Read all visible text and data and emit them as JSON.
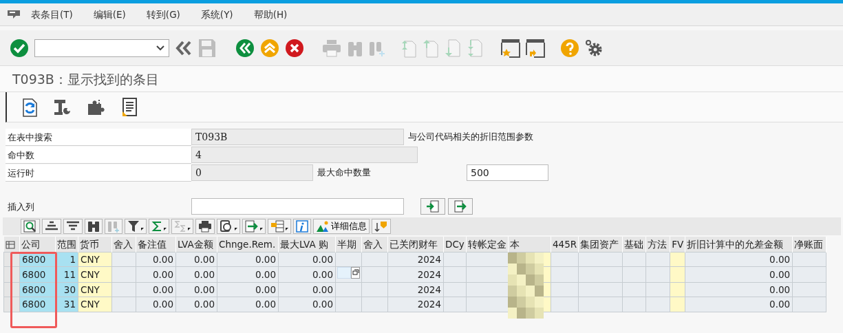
{
  "menu": [
    {
      "label": "表条目(T)"
    },
    {
      "label": "编辑(E)"
    },
    {
      "label": "转到(G)"
    },
    {
      "label": "系统(Y)"
    },
    {
      "label": "帮助(H)"
    }
  ],
  "toolbar": [
    {
      "kind": "check",
      "disabled": false
    },
    {
      "kind": "command-field",
      "disabled": false
    },
    {
      "kind": "chevrons",
      "disabled": false
    },
    {
      "kind": "save",
      "disabled": true
    },
    {
      "kind": "back",
      "disabled": false
    },
    {
      "kind": "exit",
      "disabled": false
    },
    {
      "kind": "cancel",
      "disabled": false
    },
    {
      "kind": "print",
      "disabled": true
    },
    {
      "kind": "find",
      "disabled": true
    },
    {
      "kind": "find-next",
      "disabled": true
    },
    {
      "kind": "page-first",
      "disabled": true
    },
    {
      "kind": "page-up",
      "disabled": true
    },
    {
      "kind": "page-down",
      "disabled": true
    },
    {
      "kind": "page-last",
      "disabled": true
    },
    {
      "kind": "new-window",
      "disabled": false
    },
    {
      "kind": "shortcut",
      "disabled": false
    },
    {
      "kind": "help",
      "disabled": false
    },
    {
      "kind": "settings",
      "disabled": false
    }
  ],
  "title": "T093B：显示找到的条目",
  "app_toolbar": [
    {
      "kind": "refresh"
    },
    {
      "kind": "tools"
    },
    {
      "kind": "puzzle"
    },
    {
      "kind": "document"
    }
  ],
  "form": {
    "rows": [
      {
        "label": "在表中搜索",
        "value": "T093B",
        "note": "与公司代码相关的折旧范围参数"
      },
      {
        "label": "命中数",
        "value": "4"
      },
      {
        "label": "运行时",
        "value": "0",
        "extra_label": "最大命中数量",
        "extra_value": "500"
      }
    ],
    "insert_label": "插入列"
  },
  "alv_toolbar": [
    {
      "kind": "details",
      "menu": false
    },
    {
      "kind": "sort-up",
      "menu": false
    },
    {
      "kind": "sort-down",
      "menu": false
    },
    {
      "kind": "find",
      "menu": false
    },
    {
      "kind": "find-next",
      "menu": false,
      "disabled": true
    },
    {
      "kind": "filter",
      "menu": true
    },
    {
      "kind": "sum",
      "menu": true
    },
    {
      "kind": "subtotal",
      "menu": true,
      "disabled": true
    },
    {
      "kind": "print",
      "menu": false
    },
    {
      "kind": "views",
      "menu": true
    },
    {
      "kind": "export",
      "menu": true
    },
    {
      "kind": "layout",
      "menu": true
    },
    {
      "kind": "info",
      "menu": false
    },
    {
      "kind": "chart",
      "menu": false,
      "label": "详细信息"
    },
    {
      "kind": "sort-cols",
      "menu": false
    }
  ],
  "table": {
    "columns": [
      {
        "label": "公司",
        "kind": "key",
        "numeric": false
      },
      {
        "label": "范围",
        "kind": "key",
        "numeric": true
      },
      {
        "label": "货币",
        "kind": "required",
        "numeric": false
      },
      {
        "label": "舍入",
        "kind": "plain"
      },
      {
        "label": "备注值",
        "kind": "plain",
        "numeric": true
      },
      {
        "label": "LVA金额",
        "kind": "plain",
        "numeric": true
      },
      {
        "label": "Chnge.Rem.",
        "kind": "plain",
        "numeric": true
      },
      {
        "label": "最大LVA 购",
        "kind": "plain",
        "numeric": true
      },
      {
        "label": "半期",
        "kind": "plain"
      },
      {
        "label": "舍入",
        "kind": "plain"
      },
      {
        "label": "已关闭财年",
        "kind": "plain",
        "numeric": true
      },
      {
        "label": "DCy",
        "kind": "plain"
      },
      {
        "label": "转帐定金",
        "kind": "plain"
      },
      {
        "label": "本",
        "kind": "required"
      },
      {
        "label": "445R",
        "kind": "plain"
      },
      {
        "label": "集团资产",
        "kind": "plain"
      },
      {
        "label": "基础",
        "kind": "plain"
      },
      {
        "label": "方法",
        "kind": "plain"
      },
      {
        "label": "FV",
        "kind": "required"
      },
      {
        "label": "折旧计算中的允差金额",
        "kind": "plain",
        "numeric": true
      },
      {
        "label": "净账面",
        "kind": "plain"
      }
    ],
    "rows": [
      {
        "cells": [
          "6800",
          "1",
          "CNY",
          null,
          "0.00",
          "0.00",
          "0.00",
          "0.00",
          null,
          null,
          "2024",
          null,
          null,
          null,
          null,
          null,
          null,
          null,
          null,
          "0.00",
          null
        ]
      },
      {
        "cells": [
          "6800",
          "11",
          "CNY",
          null,
          "0.00",
          "0.00",
          "0.00",
          "0.00",
          {
            "focused": true
          },
          null,
          "2024",
          null,
          null,
          null,
          null,
          null,
          null,
          null,
          null,
          "0.00",
          null
        ]
      },
      {
        "cells": [
          "6800",
          "30",
          "CNY",
          null,
          "0.00",
          "0.00",
          "0.00",
          "0.00",
          null,
          null,
          "2024",
          null,
          null,
          null,
          null,
          null,
          null,
          null,
          null,
          "0.00",
          null
        ]
      },
      {
        "cells": [
          "6800",
          "31",
          "CNY",
          null,
          "0.00",
          "0.00",
          "0.00",
          "0.00",
          null,
          null,
          "2024",
          null,
          null,
          null,
          null,
          null,
          null,
          null,
          null,
          "0.00",
          null
        ]
      }
    ]
  }
}
